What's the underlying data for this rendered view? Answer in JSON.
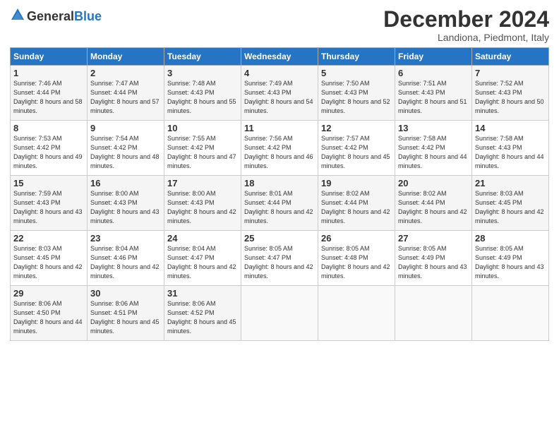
{
  "header": {
    "logo_general": "General",
    "logo_blue": "Blue",
    "month_title": "December 2024",
    "location": "Landiona, Piedmont, Italy"
  },
  "days_of_week": [
    "Sunday",
    "Monday",
    "Tuesday",
    "Wednesday",
    "Thursday",
    "Friday",
    "Saturday"
  ],
  "weeks": [
    [
      {
        "day": "1",
        "sunrise": "Sunrise: 7:46 AM",
        "sunset": "Sunset: 4:44 PM",
        "daylight": "Daylight: 8 hours and 58 minutes."
      },
      {
        "day": "2",
        "sunrise": "Sunrise: 7:47 AM",
        "sunset": "Sunset: 4:44 PM",
        "daylight": "Daylight: 8 hours and 57 minutes."
      },
      {
        "day": "3",
        "sunrise": "Sunrise: 7:48 AM",
        "sunset": "Sunset: 4:43 PM",
        "daylight": "Daylight: 8 hours and 55 minutes."
      },
      {
        "day": "4",
        "sunrise": "Sunrise: 7:49 AM",
        "sunset": "Sunset: 4:43 PM",
        "daylight": "Daylight: 8 hours and 54 minutes."
      },
      {
        "day": "5",
        "sunrise": "Sunrise: 7:50 AM",
        "sunset": "Sunset: 4:43 PM",
        "daylight": "Daylight: 8 hours and 52 minutes."
      },
      {
        "day": "6",
        "sunrise": "Sunrise: 7:51 AM",
        "sunset": "Sunset: 4:43 PM",
        "daylight": "Daylight: 8 hours and 51 minutes."
      },
      {
        "day": "7",
        "sunrise": "Sunrise: 7:52 AM",
        "sunset": "Sunset: 4:43 PM",
        "daylight": "Daylight: 8 hours and 50 minutes."
      }
    ],
    [
      {
        "day": "8",
        "sunrise": "Sunrise: 7:53 AM",
        "sunset": "Sunset: 4:42 PM",
        "daylight": "Daylight: 8 hours and 49 minutes."
      },
      {
        "day": "9",
        "sunrise": "Sunrise: 7:54 AM",
        "sunset": "Sunset: 4:42 PM",
        "daylight": "Daylight: 8 hours and 48 minutes."
      },
      {
        "day": "10",
        "sunrise": "Sunrise: 7:55 AM",
        "sunset": "Sunset: 4:42 PM",
        "daylight": "Daylight: 8 hours and 47 minutes."
      },
      {
        "day": "11",
        "sunrise": "Sunrise: 7:56 AM",
        "sunset": "Sunset: 4:42 PM",
        "daylight": "Daylight: 8 hours and 46 minutes."
      },
      {
        "day": "12",
        "sunrise": "Sunrise: 7:57 AM",
        "sunset": "Sunset: 4:42 PM",
        "daylight": "Daylight: 8 hours and 45 minutes."
      },
      {
        "day": "13",
        "sunrise": "Sunrise: 7:58 AM",
        "sunset": "Sunset: 4:42 PM",
        "daylight": "Daylight: 8 hours and 44 minutes."
      },
      {
        "day": "14",
        "sunrise": "Sunrise: 7:58 AM",
        "sunset": "Sunset: 4:43 PM",
        "daylight": "Daylight: 8 hours and 44 minutes."
      }
    ],
    [
      {
        "day": "15",
        "sunrise": "Sunrise: 7:59 AM",
        "sunset": "Sunset: 4:43 PM",
        "daylight": "Daylight: 8 hours and 43 minutes."
      },
      {
        "day": "16",
        "sunrise": "Sunrise: 8:00 AM",
        "sunset": "Sunset: 4:43 PM",
        "daylight": "Daylight: 8 hours and 43 minutes."
      },
      {
        "day": "17",
        "sunrise": "Sunrise: 8:00 AM",
        "sunset": "Sunset: 4:43 PM",
        "daylight": "Daylight: 8 hours and 42 minutes."
      },
      {
        "day": "18",
        "sunrise": "Sunrise: 8:01 AM",
        "sunset": "Sunset: 4:44 PM",
        "daylight": "Daylight: 8 hours and 42 minutes."
      },
      {
        "day": "19",
        "sunrise": "Sunrise: 8:02 AM",
        "sunset": "Sunset: 4:44 PM",
        "daylight": "Daylight: 8 hours and 42 minutes."
      },
      {
        "day": "20",
        "sunrise": "Sunrise: 8:02 AM",
        "sunset": "Sunset: 4:44 PM",
        "daylight": "Daylight: 8 hours and 42 minutes."
      },
      {
        "day": "21",
        "sunrise": "Sunrise: 8:03 AM",
        "sunset": "Sunset: 4:45 PM",
        "daylight": "Daylight: 8 hours and 42 minutes."
      }
    ],
    [
      {
        "day": "22",
        "sunrise": "Sunrise: 8:03 AM",
        "sunset": "Sunset: 4:45 PM",
        "daylight": "Daylight: 8 hours and 42 minutes."
      },
      {
        "day": "23",
        "sunrise": "Sunrise: 8:04 AM",
        "sunset": "Sunset: 4:46 PM",
        "daylight": "Daylight: 8 hours and 42 minutes."
      },
      {
        "day": "24",
        "sunrise": "Sunrise: 8:04 AM",
        "sunset": "Sunset: 4:47 PM",
        "daylight": "Daylight: 8 hours and 42 minutes."
      },
      {
        "day": "25",
        "sunrise": "Sunrise: 8:05 AM",
        "sunset": "Sunset: 4:47 PM",
        "daylight": "Daylight: 8 hours and 42 minutes."
      },
      {
        "day": "26",
        "sunrise": "Sunrise: 8:05 AM",
        "sunset": "Sunset: 4:48 PM",
        "daylight": "Daylight: 8 hours and 42 minutes."
      },
      {
        "day": "27",
        "sunrise": "Sunrise: 8:05 AM",
        "sunset": "Sunset: 4:49 PM",
        "daylight": "Daylight: 8 hours and 43 minutes."
      },
      {
        "day": "28",
        "sunrise": "Sunrise: 8:05 AM",
        "sunset": "Sunset: 4:49 PM",
        "daylight": "Daylight: 8 hours and 43 minutes."
      }
    ],
    [
      {
        "day": "29",
        "sunrise": "Sunrise: 8:06 AM",
        "sunset": "Sunset: 4:50 PM",
        "daylight": "Daylight: 8 hours and 44 minutes."
      },
      {
        "day": "30",
        "sunrise": "Sunrise: 8:06 AM",
        "sunset": "Sunset: 4:51 PM",
        "daylight": "Daylight: 8 hours and 45 minutes."
      },
      {
        "day": "31",
        "sunrise": "Sunrise: 8:06 AM",
        "sunset": "Sunset: 4:52 PM",
        "daylight": "Daylight: 8 hours and 45 minutes."
      },
      null,
      null,
      null,
      null
    ]
  ]
}
